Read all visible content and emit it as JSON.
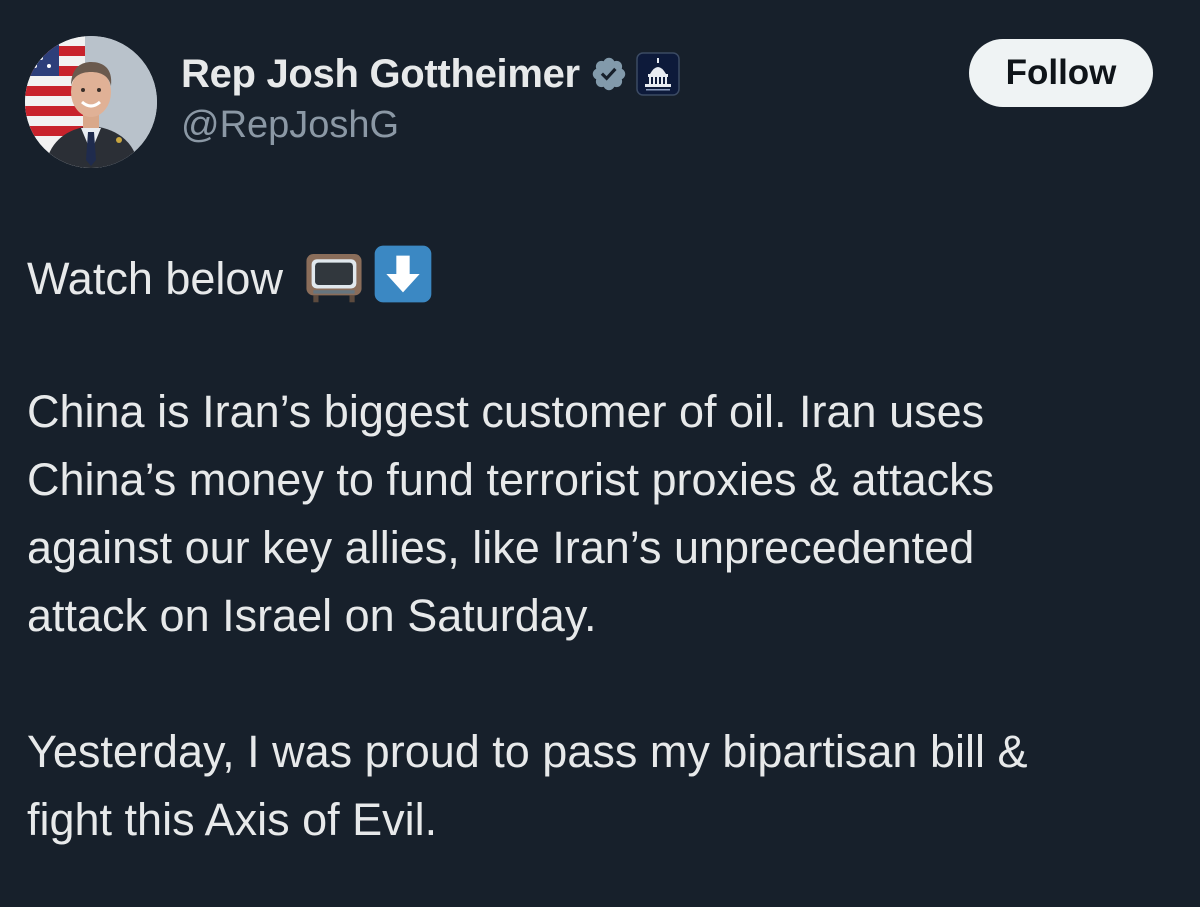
{
  "author": {
    "display_name": "Rep Josh Gottheimer",
    "handle": "@RepJoshG",
    "verified": true,
    "verified_icon": "verified-badge-icon",
    "affiliation_icon": "capitol-dome-icon"
  },
  "actions": {
    "follow_label": "Follow"
  },
  "tweet": {
    "intro": "Watch below",
    "intro_emojis": [
      "television-emoji",
      "down-arrow-emoji"
    ],
    "para1_lines": [
      "China is Iran’s biggest customer of oil. Iran uses",
      "China’s money to fund terrorist proxies & attacks",
      "against our key allies, like Iran’s unprecedented",
      "attack on Israel on Saturday."
    ],
    "para2_lines": [
      "Yesterday, I was proud to pass my bipartisan bill &",
      "fight this Axis of Evil."
    ]
  },
  "colors": {
    "background": "#17202b",
    "text_primary": "#e7e9ea",
    "text_secondary": "#8b98a5",
    "follow_bg": "#eff3f4",
    "verified_gray": "#829aab",
    "emoji_blue": "#3b88c3"
  }
}
